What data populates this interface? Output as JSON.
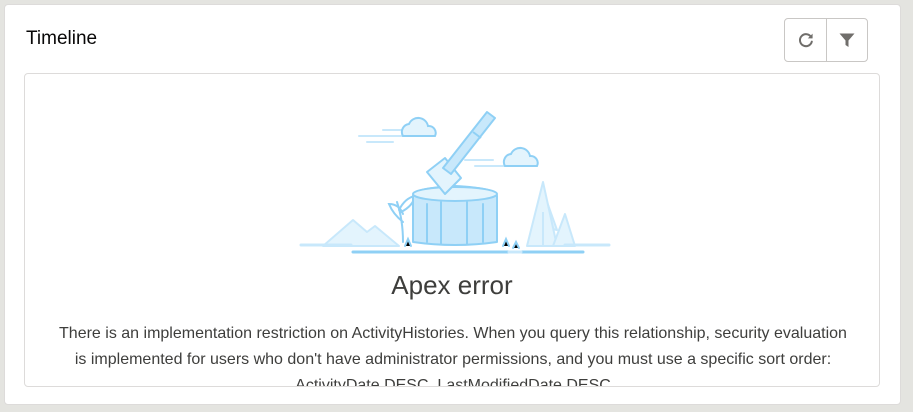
{
  "card": {
    "title": "Timeline",
    "actions": {
      "refresh_icon": "refresh-icon",
      "filter_icon": "filter-icon"
    }
  },
  "empty_state": {
    "illustration": "axe-in-stump-illustration",
    "title": "Apex error",
    "message": "There is an implementation restriction on ActivityHistories. When you query this relationship, security evaluation is implemented for users who don't have administrator permissions, and you must use a specific sort order: ActivityDate DESC, LastModifiedDate DESC"
  },
  "colors": {
    "illustration_stroke": "#8fd0f5",
    "illustration_fill": "#c8e8fb",
    "illustration_light": "#e3f4fd",
    "text": "#3e3e3c",
    "border": "#dddbda",
    "icon": "#706e6b"
  }
}
